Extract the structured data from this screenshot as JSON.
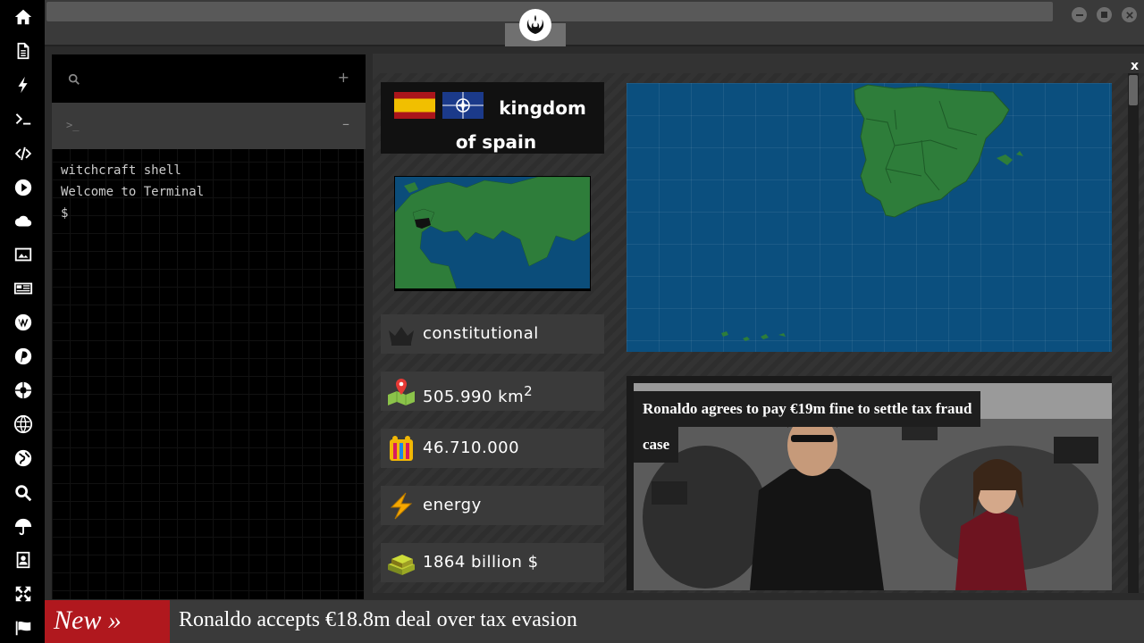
{
  "sidebar": {
    "icons": [
      "home-icon",
      "document-icon",
      "bolt-icon",
      "terminal-icon",
      "code-icon",
      "play-icon",
      "cloud-icon",
      "image-icon",
      "newspaper-icon",
      "wordpress-icon",
      "pinterest-icon",
      "aperture-icon",
      "globe-wire-icon",
      "globe-icon",
      "search-icon",
      "umbrella-icon",
      "contacts-icon",
      "expand-icon",
      "flag-icon"
    ]
  },
  "terminal": {
    "prompt_glyph": ">_",
    "lines": [
      "witchcraft shell",
      "Welcome to Terminal",
      "$"
    ],
    "plus": "+",
    "minus": "–"
  },
  "country": {
    "name": "kingdom of spain",
    "government": "constitutional",
    "area": "505.990 km",
    "area_sup": "2",
    "population": "46.710.000",
    "economy": "energy",
    "gdp": "1864 billion $"
  },
  "news": {
    "headline_line1": "Ronaldo agrees to pay €19m fine to settle tax fraud",
    "headline_line2": "case"
  },
  "ticker": {
    "label": "New »",
    "text": "Ronaldo accepts €18.8m deal over tax evasion"
  },
  "panel": {
    "close": "x"
  },
  "colors": {
    "accent": "#b0181e",
    "map_sea": "#0b4f7e",
    "map_land": "#2e7d3a"
  }
}
